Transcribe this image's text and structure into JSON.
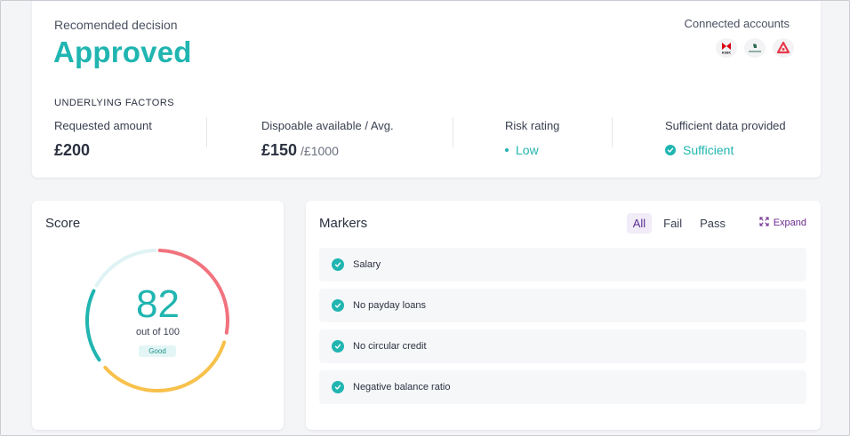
{
  "decision": {
    "label": "Recomended decision",
    "value": "Approved"
  },
  "connected": {
    "label": "Connected accounts",
    "banks": [
      {
        "name": "HSBC",
        "icon": "hsbc-logo-icon"
      },
      {
        "name": "Lloyds Bank",
        "icon": "lloyds-logo-icon"
      },
      {
        "name": "Santander",
        "icon": "santander-logo-icon"
      }
    ]
  },
  "factors": {
    "title": "UNDERLYING FACTORS",
    "requested": {
      "label": "Requested amount",
      "value": "£200"
    },
    "disposable": {
      "label": "Dispoable available / Avg.",
      "value": "£150",
      "avg": "/£1000"
    },
    "risk": {
      "label": "Risk rating",
      "value": "Low"
    },
    "sufficient": {
      "label": "Sufficient data provided",
      "value": "Sufficient"
    }
  },
  "score": {
    "title": "Score",
    "value": "82",
    "subtitle": "out of 100",
    "badge": "Good"
  },
  "markers": {
    "title": "Markers",
    "filters": [
      "All",
      "Fail",
      "Pass"
    ],
    "active_filter": "All",
    "expand_label": "Expand",
    "items": [
      "Salary",
      "No payday loans",
      "No circular credit",
      "Negative balance ratio"
    ]
  },
  "colors": {
    "accent": "#20b5b0",
    "purple": "#5c2d91",
    "gauge_red": "#f0737e",
    "gauge_yellow": "#f8c14b",
    "gauge_teal": "#20b5b0",
    "gauge_light": "#dff3f4"
  }
}
